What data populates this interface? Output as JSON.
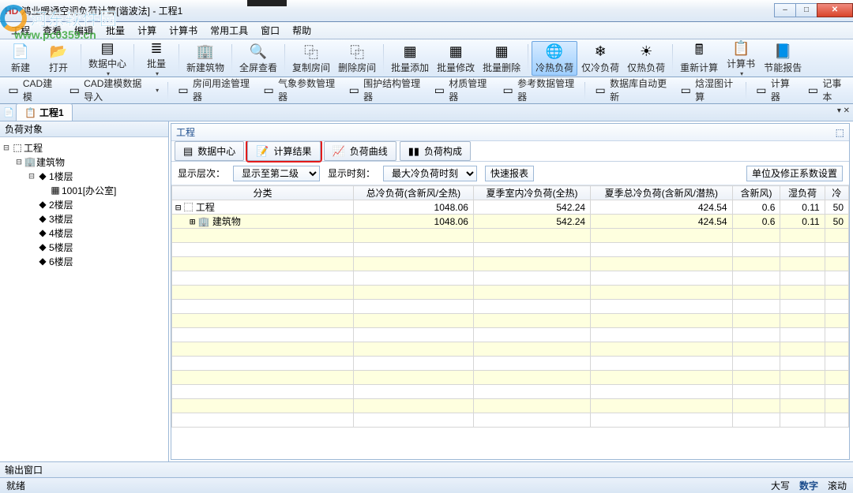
{
  "window": {
    "title": "鸿业暖通空调负荷计算[谐波法] - 工程1",
    "min_icon": "–",
    "max_icon": "□",
    "close_icon": "✕"
  },
  "watermark": {
    "text": "河东软件园",
    "url": "www.pc0359.cn"
  },
  "menu": [
    "工程",
    "查看",
    "编辑",
    "批量",
    "计算",
    "计算书",
    "常用工具",
    "窗口",
    "帮助"
  ],
  "toolbar1": [
    {
      "label": "新建",
      "icon": "📄"
    },
    {
      "label": "打开",
      "icon": "📂",
      "sep": true
    },
    {
      "label": "数据中心",
      "icon": "▤",
      "dd": true,
      "sep": true
    },
    {
      "label": "批量",
      "icon": "≣",
      "dd": true,
      "sep": true
    },
    {
      "label": "新建筑物",
      "icon": "🏢",
      "sep": true
    },
    {
      "label": "全屏查看",
      "icon": "🔍",
      "sep": true
    },
    {
      "label": "复制房间",
      "icon": "⿻"
    },
    {
      "label": "删除房间",
      "icon": "⿻",
      "sep": true
    },
    {
      "label": "批量添加",
      "icon": "▦"
    },
    {
      "label": "批量修改",
      "icon": "▦"
    },
    {
      "label": "批量删除",
      "icon": "▦",
      "sep": true
    },
    {
      "label": "冷热负荷",
      "icon": "🌐",
      "active": true
    },
    {
      "label": "仅冷负荷",
      "icon": "❄"
    },
    {
      "label": "仅热负荷",
      "icon": "☀",
      "sep": true
    },
    {
      "label": "重新计算",
      "icon": "🖩"
    },
    {
      "label": "计算书",
      "icon": "📋",
      "dd": true
    },
    {
      "label": "节能报告",
      "icon": "📘"
    }
  ],
  "toolbar2": [
    {
      "label": "CAD建模",
      "icon": "▭"
    },
    {
      "label": "CAD建模数据导入",
      "icon": "▭",
      "dd": true,
      "sep": true
    },
    {
      "label": "房间用途管理器",
      "icon": "▭"
    },
    {
      "label": "气象参数管理器",
      "icon": "▭"
    },
    {
      "label": "围护结构管理器",
      "icon": "▭"
    },
    {
      "label": "材质管理器",
      "icon": "▭"
    },
    {
      "label": "参考数据管理器",
      "icon": "▭",
      "sep": true
    },
    {
      "label": "数据库自动更新",
      "icon": "▭"
    },
    {
      "label": "焓湿图计算",
      "icon": "▭",
      "sep": true
    },
    {
      "label": "计算器",
      "icon": "▭"
    },
    {
      "label": "记事本",
      "icon": "▭"
    }
  ],
  "doctab": {
    "title": "工程1",
    "icon": "📋"
  },
  "sidepane": {
    "title": "负荷对象",
    "tree": [
      {
        "depth": 0,
        "tw": "⊟",
        "ic": "⬚",
        "label": "工程"
      },
      {
        "depth": 1,
        "tw": "⊟",
        "ic": "🏢",
        "label": "建筑物"
      },
      {
        "depth": 2,
        "tw": "⊟",
        "ic": "◆",
        "label": "1楼层"
      },
      {
        "depth": 3,
        "tw": "",
        "ic": "▦",
        "label": "1001[办公室]",
        "sel": true
      },
      {
        "depth": 2,
        "tw": "",
        "ic": "◆",
        "label": "2楼层"
      },
      {
        "depth": 2,
        "tw": "",
        "ic": "◆",
        "label": "3楼层"
      },
      {
        "depth": 2,
        "tw": "",
        "ic": "◆",
        "label": "4楼层"
      },
      {
        "depth": 2,
        "tw": "",
        "ic": "◆",
        "label": "5楼层"
      },
      {
        "depth": 2,
        "tw": "",
        "ic": "◆",
        "label": "6楼层"
      }
    ]
  },
  "content": {
    "header": "工程",
    "subtabs": [
      {
        "icon": "▤",
        "label": "数据中心"
      },
      {
        "icon": "📝",
        "label": "计算结果",
        "hl": true
      },
      {
        "icon": "📈",
        "label": "负荷曲线"
      },
      {
        "icon": "▮▮",
        "label": "负荷构成"
      }
    ],
    "filter": {
      "level_label": "显示层次：",
      "level_value": "显示至第二级",
      "time_label": "显示时刻：",
      "time_value": "最大冷负荷时刻",
      "quick_report": "快速报表",
      "unit_btn": "单位及修正系数设置"
    },
    "grid": {
      "columns": [
        "分类",
        "总冷负荷(含新风/全热)",
        "夏季室内冷负荷(全热)",
        "夏季总冷负荷(含新风/潜热)",
        "含新风)",
        "湿负荷",
        "冷"
      ],
      "rows": [
        {
          "tw": "⊟",
          "ic": "⬚",
          "label": "工程",
          "v": [
            "1048.06",
            "542.24",
            "424.54",
            "0.6",
            "0.11",
            "50"
          ]
        },
        {
          "tw": "⊞",
          "ic": "🏢",
          "label": "建筑物",
          "v": [
            "1048.06",
            "542.24",
            "424.54",
            "0.6",
            "0.11",
            "50"
          ],
          "indent": 1
        }
      ]
    }
  },
  "bottompane": {
    "title": "输出窗口"
  },
  "status": {
    "left": "就绪",
    "right": [
      "大写",
      "数字",
      "滚动"
    ],
    "on_index": 1
  }
}
